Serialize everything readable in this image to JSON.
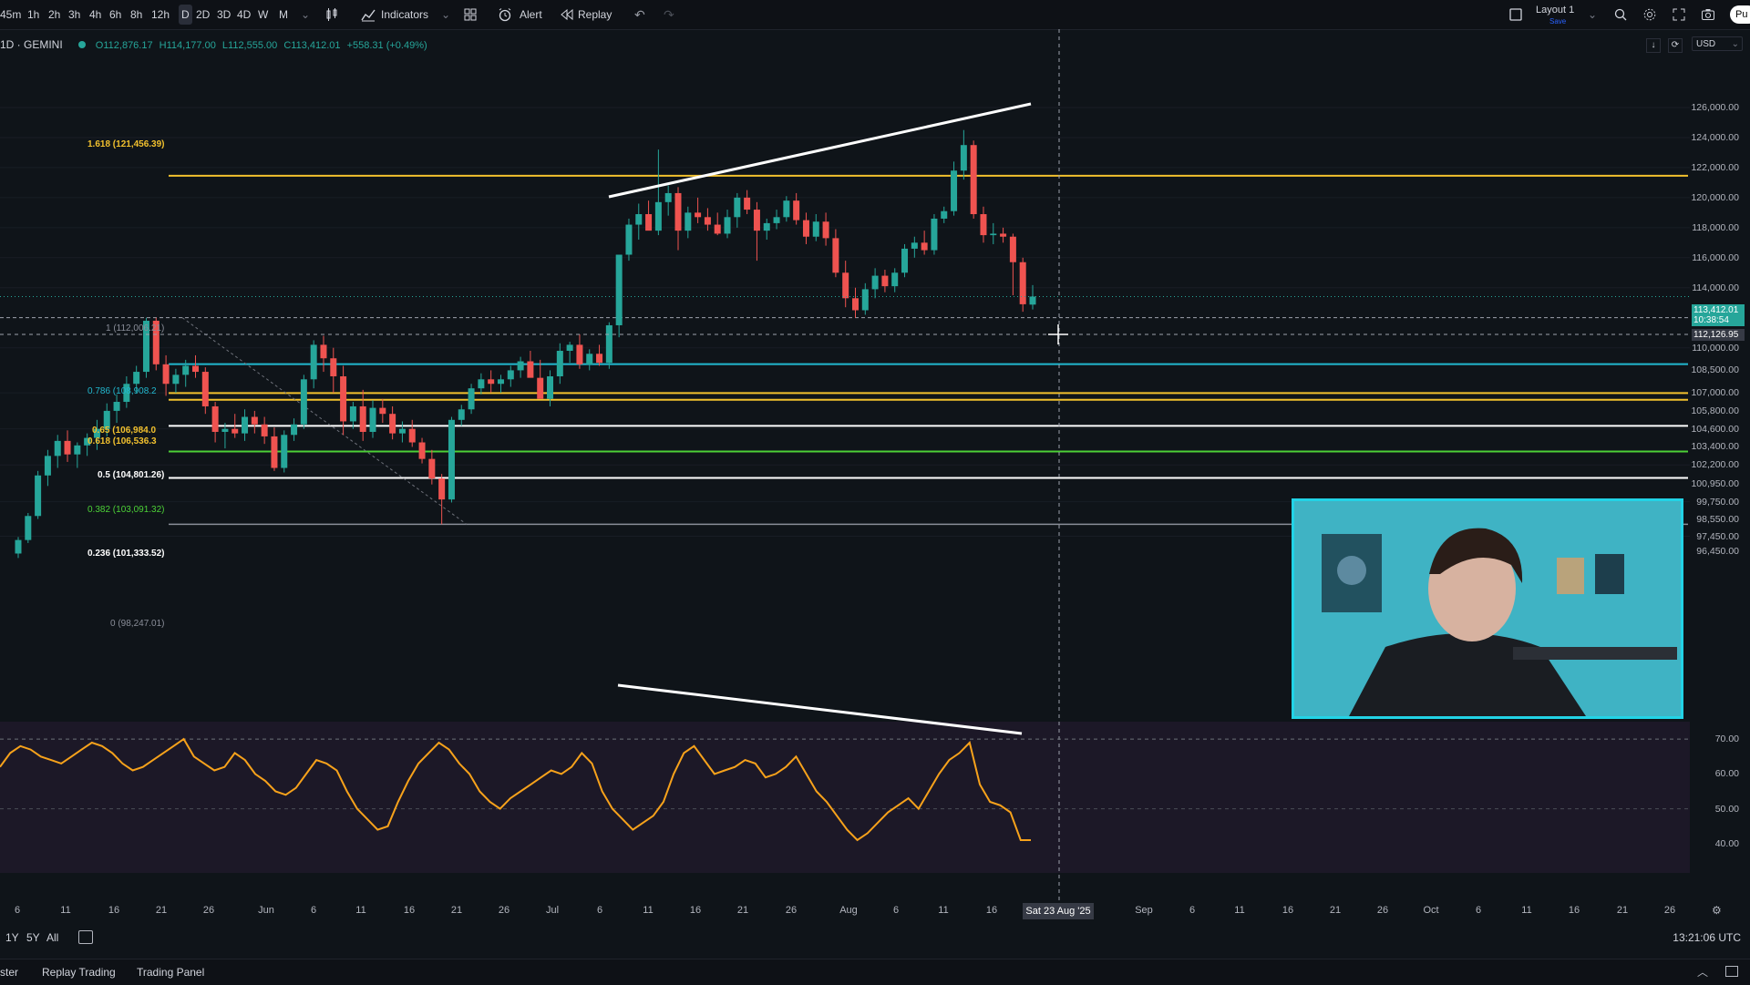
{
  "toolbar": {
    "intervals": [
      "45m",
      "1h",
      "2h",
      "3h",
      "4h",
      "6h",
      "8h",
      "12h",
      "D",
      "2D",
      "3D",
      "4D",
      "W",
      "M"
    ],
    "active_interval": "D",
    "indicators_label": "Indicators",
    "alert_label": "Alert",
    "replay_label": "Replay",
    "layout_label": "Layout 1",
    "layout_sub": "Save",
    "publish_label": "Pu"
  },
  "legend": {
    "symbol": "1D · GEMINI",
    "open": "O112,876.17",
    "high": "H114,177.00",
    "low": "L112,555.00",
    "close": "C113,412.01",
    "change": "+558.31 (+0.49%)"
  },
  "currency": "USD",
  "price_axis": {
    "labels": [
      "126,000.00",
      "124,000.00",
      "122,000.00",
      "120,000.00",
      "118,000.00",
      "116,000.00",
      "114,000.00",
      "110,000.00",
      "108,500.00",
      "107,000.00",
      "105,800.00",
      "104,600.00",
      "103,400.00",
      "102,200.00",
      "100,950.00",
      "99,750.00",
      "98,550.00",
      "97,450.00",
      "96,450.00"
    ],
    "current_price": "113,412.01",
    "countdown": "10:38:54",
    "crosshair_price": "112,126.95"
  },
  "rsi_axis": {
    "labels": [
      "70.00",
      "60.00",
      "50.00",
      "40.00"
    ]
  },
  "fib_levels": [
    {
      "label": "1.618 (121,456.39)",
      "color": "#f2c12e"
    },
    {
      "label": "1 (112,006.21)",
      "color": "#8a8e99"
    },
    {
      "label": "0.786 (108,908.2",
      "color": "#22b8cf"
    },
    {
      "label": "0.65 (106,984.0",
      "color": "#f2c12e"
    },
    {
      "label": "0.618 (106,536.3",
      "color": "#f2c12e"
    },
    {
      "label": "0.5 (104,801.26)",
      "color": "#ffffff"
    },
    {
      "label": "0.382 (103,091.32)",
      "color": "#4cd137"
    },
    {
      "label": "0.236 (101,333.52)",
      "color": "#ffffff"
    },
    {
      "label": "0 (98,247.01)",
      "color": "#8a8e99"
    }
  ],
  "time_axis": {
    "labels": [
      "6",
      "11",
      "16",
      "21",
      "26",
      "Jun",
      "6",
      "11",
      "16",
      "21",
      "26",
      "Jul",
      "6",
      "11",
      "16",
      "21",
      "26",
      "Aug",
      "6",
      "11",
      "16",
      "Sep",
      "6",
      "11",
      "16",
      "21",
      "26",
      "Oct",
      "6",
      "11",
      "16",
      "21",
      "26"
    ],
    "crosshair_date": "Sat 23 Aug '25"
  },
  "ranges": [
    "1Y",
    "5Y",
    "All"
  ],
  "clock": "13:21:06 UTC",
  "bottom_tabs": [
    "ster",
    "Replay Trading",
    "Trading Panel"
  ],
  "colors": {
    "up": "#26a69a",
    "down": "#ef5350",
    "rsi": "#f7a21b",
    "accent": "#22d3e6"
  },
  "chart_data": {
    "type": "candlestick",
    "symbol": "BTC/USD 1D GEMINI",
    "price_ylim": [
      96000,
      126500
    ],
    "candles": [
      [
        96300,
        97400,
        96000,
        97200
      ],
      [
        97200,
        99000,
        97000,
        98800
      ],
      [
        98800,
        101800,
        98600,
        101500
      ],
      [
        101500,
        103200,
        100800,
        102800
      ],
      [
        102800,
        104200,
        102000,
        103800
      ],
      [
        103800,
        104500,
        102400,
        102900
      ],
      [
        102900,
        103700,
        102000,
        103500
      ],
      [
        103500,
        104300,
        102800,
        104000
      ],
      [
        104000,
        105200,
        103200,
        104600
      ],
      [
        104600,
        106300,
        104100,
        105800
      ],
      [
        105800,
        106900,
        105000,
        106400
      ],
      [
        106400,
        108100,
        106000,
        107600
      ],
      [
        107600,
        108800,
        107000,
        108400
      ],
      [
        108400,
        112000,
        108000,
        111800
      ],
      [
        111800,
        112000,
        108500,
        108900
      ],
      [
        108900,
        109500,
        106800,
        107600
      ],
      [
        107600,
        108600,
        107000,
        108200
      ],
      [
        108200,
        109200,
        107400,
        108800
      ],
      [
        108800,
        109500,
        108000,
        108400
      ],
      [
        108400,
        108700,
        105600,
        106100
      ],
      [
        106100,
        106400,
        103700,
        104400
      ],
      [
        104400,
        105000,
        103300,
        104600
      ],
      [
        104600,
        105600,
        104000,
        104300
      ],
      [
        104300,
        105900,
        103800,
        105400
      ],
      [
        105400,
        105800,
        104300,
        104900
      ],
      [
        104900,
        105400,
        103600,
        104100
      ],
      [
        104100,
        104700,
        101800,
        102000
      ],
      [
        102000,
        104500,
        101700,
        104200
      ],
      [
        104200,
        105300,
        103800,
        104900
      ],
      [
        104900,
        108200,
        104600,
        107900
      ],
      [
        107900,
        110500,
        107300,
        110200
      ],
      [
        110200,
        110800,
        108400,
        109300
      ],
      [
        109300,
        110000,
        107000,
        108100
      ],
      [
        108100,
        108800,
        104200,
        105100
      ],
      [
        105100,
        106400,
        104600,
        106100
      ],
      [
        106100,
        107200,
        103800,
        104400
      ],
      [
        104400,
        106500,
        104000,
        106000
      ],
      [
        106000,
        106600,
        105000,
        105600
      ],
      [
        105600,
        106100,
        103900,
        104300
      ],
      [
        104300,
        105100,
        103700,
        104600
      ],
      [
        104600,
        105200,
        103400,
        103700
      ],
      [
        103700,
        104000,
        102300,
        102600
      ],
      [
        102600,
        103200,
        100900,
        101300
      ],
      [
        101300,
        101600,
        98247,
        99900
      ],
      [
        99900,
        105400,
        99700,
        105200
      ],
      [
        105200,
        106200,
        104800,
        105900
      ],
      [
        105900,
        107600,
        105600,
        107300
      ],
      [
        107300,
        108300,
        106900,
        107900
      ],
      [
        107900,
        108500,
        107000,
        107600
      ],
      [
        107600,
        108200,
        107000,
        107900
      ],
      [
        107900,
        108800,
        107400,
        108500
      ],
      [
        108500,
        109400,
        108000,
        109100
      ],
      [
        109100,
        109800,
        108600,
        108000
      ],
      [
        108000,
        109200,
        107400,
        106600
      ],
      [
        106600,
        108500,
        106100,
        108100
      ],
      [
        108100,
        110300,
        107600,
        109800
      ],
      [
        109800,
        110400,
        109000,
        110200
      ],
      [
        110200,
        110900,
        108600,
        108900
      ],
      [
        108900,
        109900,
        108500,
        109600
      ],
      [
        109600,
        110200,
        108800,
        109000
      ],
      [
        109000,
        111700,
        108600,
        111500
      ],
      [
        111500,
        112500,
        110700,
        116200
      ],
      [
        116200,
        118600,
        115800,
        118200
      ],
      [
        118200,
        119600,
        117200,
        118900
      ],
      [
        118900,
        119800,
        118000,
        117800
      ],
      [
        117800,
        123200,
        117500,
        119700
      ],
      [
        119700,
        120800,
        118800,
        120300
      ],
      [
        120300,
        120700,
        116500,
        117800
      ],
      [
        117800,
        119400,
        117300,
        119000
      ],
      [
        119000,
        120000,
        118300,
        118700
      ],
      [
        118700,
        119300,
        117800,
        118200
      ],
      [
        118200,
        119000,
        117500,
        117600
      ],
      [
        117600,
        119200,
        117300,
        118700
      ],
      [
        118700,
        120300,
        118000,
        120000
      ],
      [
        120000,
        120500,
        118900,
        119200
      ],
      [
        119200,
        119700,
        115800,
        117800
      ],
      [
        117800,
        118600,
        117200,
        118300
      ],
      [
        118300,
        119200,
        117900,
        118700
      ],
      [
        118700,
        120100,
        118400,
        119800
      ],
      [
        119800,
        120300,
        118200,
        118500
      ],
      [
        118500,
        119000,
        116900,
        117400
      ],
      [
        117400,
        118900,
        117100,
        118400
      ],
      [
        118400,
        119000,
        116800,
        117300
      ],
      [
        117300,
        117900,
        114700,
        115000
      ],
      [
        115000,
        115800,
        112700,
        113300
      ],
      [
        113300,
        114000,
        112000,
        112500
      ],
      [
        112500,
        114300,
        112200,
        113900
      ],
      [
        113900,
        115300,
        113300,
        114800
      ],
      [
        114800,
        115200,
        113700,
        114100
      ],
      [
        114100,
        115300,
        113700,
        115000
      ],
      [
        115000,
        116900,
        114700,
        116600
      ],
      [
        116600,
        117400,
        116000,
        117000
      ],
      [
        117000,
        117800,
        116200,
        116500
      ],
      [
        116500,
        118900,
        116200,
        118600
      ],
      [
        118600,
        119400,
        118300,
        119100
      ],
      [
        119100,
        122400,
        118800,
        121800
      ],
      [
        121800,
        124500,
        121200,
        123500
      ],
      [
        123500,
        123800,
        118600,
        118900
      ],
      [
        118900,
        119400,
        117000,
        117500
      ],
      [
        117500,
        118300,
        116900,
        117600
      ],
      [
        117600,
        118000,
        117000,
        117400
      ],
      [
        117400,
        117600,
        113500,
        115700
      ],
      [
        115700,
        116000,
        112400,
        112900
      ],
      [
        112876,
        114177,
        112555,
        113412
      ]
    ],
    "rsi": [
      62,
      66,
      68,
      67,
      65,
      64,
      63,
      65,
      67,
      69,
      68,
      66,
      63,
      61,
      62,
      64,
      66,
      68,
      70,
      65,
      63,
      61,
      62,
      66,
      64,
      60,
      58,
      55,
      54,
      56,
      60,
      64,
      63,
      61,
      55,
      50,
      47,
      44,
      45,
      52,
      58,
      63,
      66,
      69,
      67,
      63,
      60,
      55,
      52,
      50,
      53,
      55,
      57,
      59,
      61,
      60,
      62,
      66,
      63,
      55,
      50,
      47,
      44,
      46,
      48,
      52,
      60,
      66,
      68,
      64,
      60,
      61,
      62,
      64,
      63,
      59,
      60,
      62,
      65,
      60,
      55,
      52,
      48,
      44,
      41,
      43,
      46,
      49,
      51,
      53,
      50,
      55,
      60,
      64,
      66,
      69,
      57,
      52,
      51,
      49,
      41,
      41
    ],
    "rsi_ylim": [
      35,
      75
    ],
    "rsi_levels": [
      70,
      50
    ]
  }
}
